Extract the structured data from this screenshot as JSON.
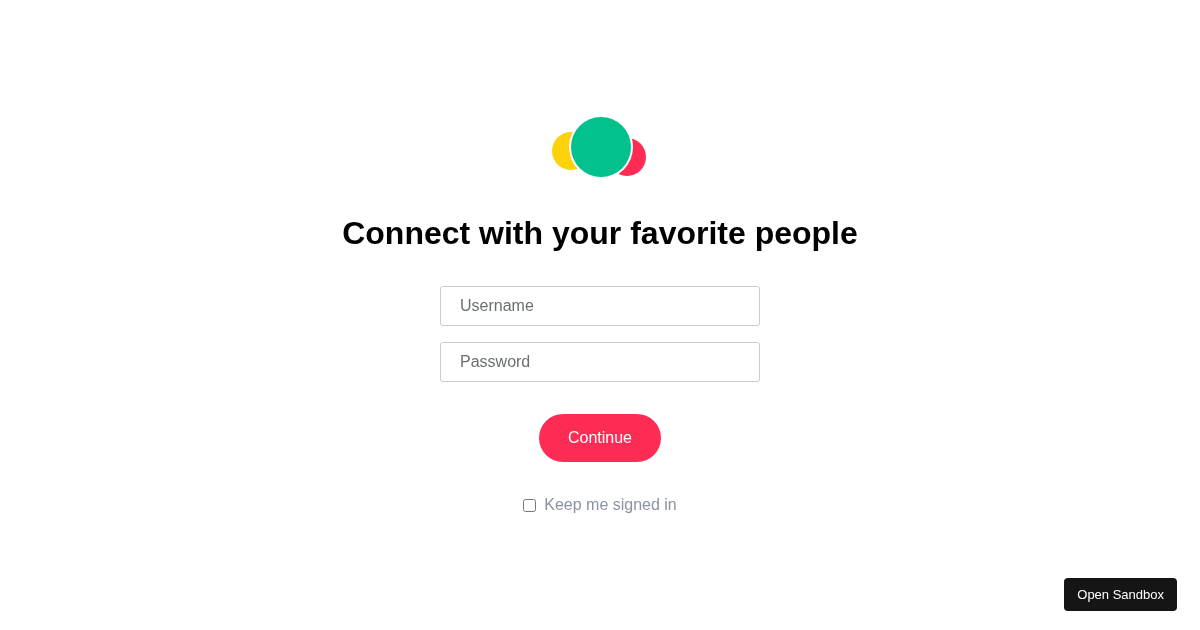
{
  "heading": "Connect with your favorite people",
  "fields": [
    {
      "placeholder": "Username"
    },
    {
      "placeholder": "Password"
    }
  ],
  "continue_button": "Continue",
  "keep_signed_in": {
    "label": "Keep me signed in",
    "checked": false
  },
  "sandbox_button": "Open Sandbox"
}
